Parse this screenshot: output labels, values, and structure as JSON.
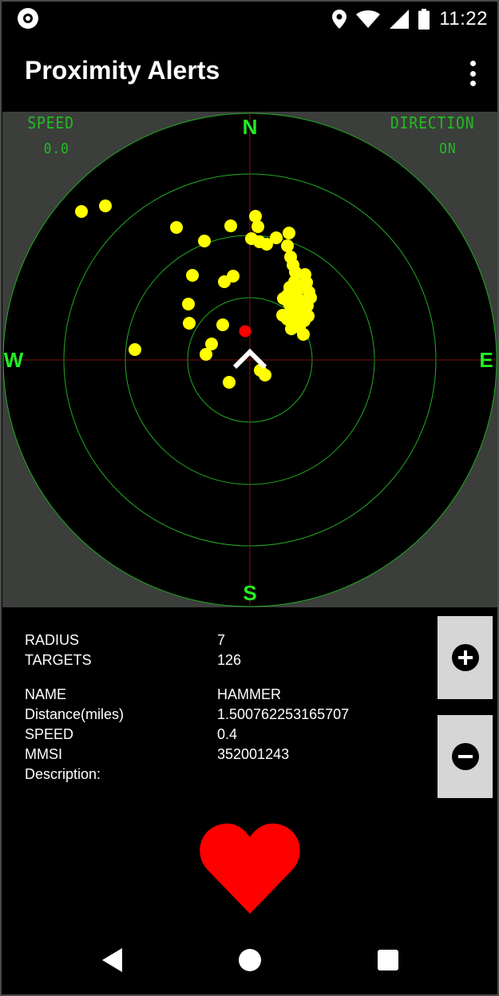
{
  "status_bar": {
    "time": "11:22",
    "icons": [
      "record-icon",
      "location-icon",
      "wifi-icon",
      "cell-signal-icon",
      "battery-icon"
    ]
  },
  "app_bar": {
    "title": "Proximity Alerts",
    "menu_icon": "overflow-menu-icon"
  },
  "radar": {
    "speed_label": "SPEED",
    "speed_value": "0.0",
    "direction_label": "DIRECTION",
    "direction_value": "ON",
    "compass": {
      "north": "N",
      "south": "S",
      "east": "E",
      "west": "W"
    },
    "colors": {
      "background": "#3b3e3b",
      "scope": "#000000",
      "ring": "#22aa22",
      "crosshair": "#7a1515",
      "target": "#ffff00",
      "selected_target": "#ff0000",
      "heading": "#ffffff",
      "hud_text": "#22bb22",
      "compass_text": "#22ee22"
    }
  },
  "info": {
    "radius_label": "RADIUS",
    "radius_value": "7",
    "targets_label": "TARGETS",
    "targets_value": "126",
    "name_label": "NAME",
    "name_value": "HAMMER",
    "distance_label": "Distance(miles)",
    "distance_value": "1.500762253165707",
    "speed_label": "SPEED",
    "speed_value": "0.4",
    "mmsi_label": "MMSI",
    "mmsi_value": "352001243",
    "description_label": "Description:",
    "description_value": ""
  },
  "zoom": {
    "zoom_in_icon": "plus-icon",
    "zoom_out_icon": "minus-icon"
  },
  "favorite_icon": "heart-icon",
  "nav_bar": {
    "back_icon": "back-icon",
    "home_icon": "home-icon",
    "recents_icon": "recents-icon"
  }
}
